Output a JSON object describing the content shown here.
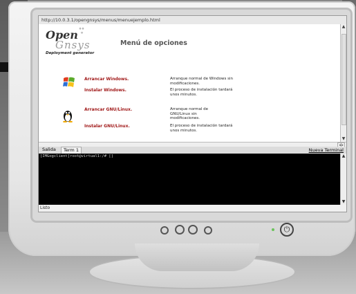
{
  "browser": {
    "url": "http://10.0.3.1/opengnsys/menus/menuejemplo.html"
  },
  "logo": {
    "line1": "Open",
    "line2": "Gnsys",
    "tagline": "Deployment generator"
  },
  "page": {
    "title": "Menú de opciones",
    "options": [
      {
        "label": "Arrancar Windows.",
        "description": "Arranque normal de Windows sin modificaciones.",
        "icon": "windows-icon"
      },
      {
        "label": "Instalar Windows.",
        "description": "El proceso de instalación tardará unos minutos.",
        "icon": ""
      },
      {
        "label": "Arrancar GNU/Linux.",
        "description": "Arranque normal de GNU/Linux sin modificaciones.",
        "icon": "tux-icon"
      },
      {
        "label": "Instalar GNU/Linux.",
        "description": "El proceso de instalación tardará unos minutos.",
        "icon": ""
      }
    ]
  },
  "tabs": {
    "salida": "Salida",
    "term1": "Term 1",
    "new_terminal": "Nueva Terminal"
  },
  "terminal": {
    "prompt": "[IMGogclient]root@virtual1:/# []"
  },
  "status": {
    "text": "Listo"
  },
  "colors": {
    "option_link": "#a01818",
    "terminal_bg": "#000000",
    "power_led": "#6ac35a"
  }
}
